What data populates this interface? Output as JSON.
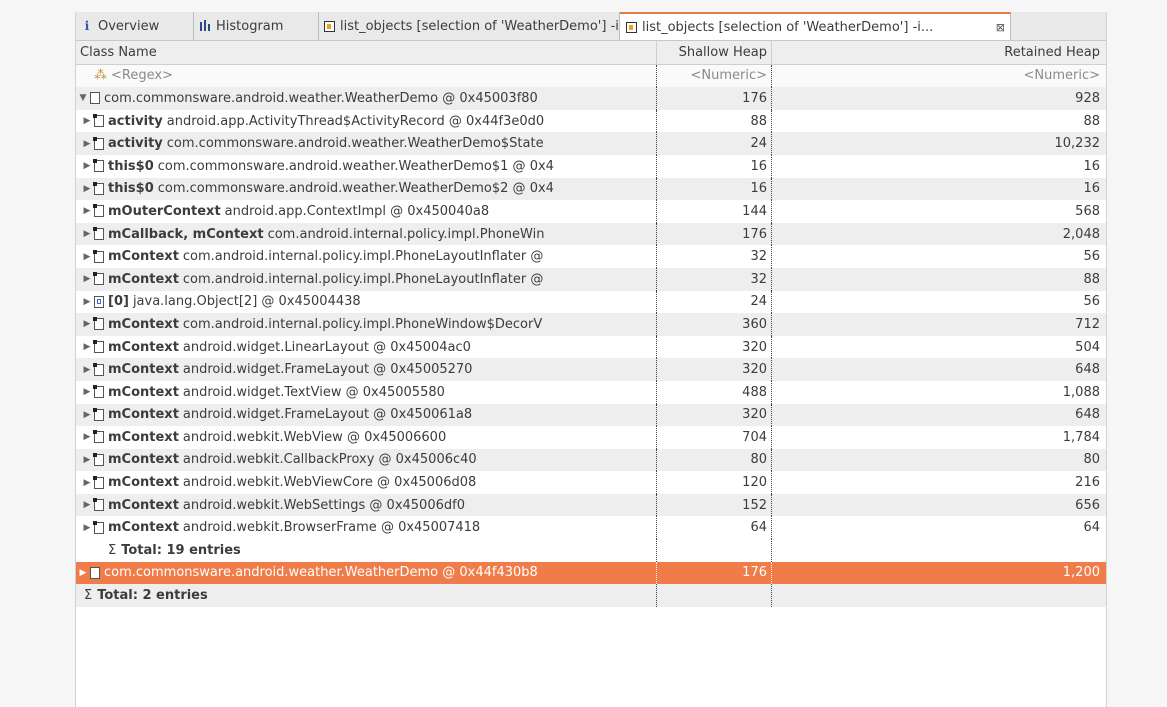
{
  "tabs": [
    {
      "icon": "info-icon",
      "label": "Overview"
    },
    {
      "icon": "histogram-icon",
      "label": "Histogram"
    },
    {
      "icon": "list-objects-icon",
      "label": "list_objects [selection of 'WeatherDemo'] -i..."
    },
    {
      "icon": "list-objects-icon",
      "label": "list_objects [selection of 'WeatherDemo'] -i...",
      "active": true,
      "close": "⊠"
    }
  ],
  "columns": {
    "class_name": "Class Name",
    "shallow_heap": "Shallow Heap",
    "retained_heap": "Retained Heap"
  },
  "filters": {
    "regex": "<Regex>",
    "shallow": "<Numeric>",
    "retained": "<Numeric>"
  },
  "root": {
    "name": "com.commonsware.android.weather.WeatherDemo @ 0x45003f80",
    "shallow": "176",
    "retained": "928"
  },
  "children": [
    {
      "field": "activity",
      "text": "android.app.ActivityThread$ActivityRecord @ 0x44f3e0d0",
      "shallow": "88",
      "retained": "88",
      "icon": "ref"
    },
    {
      "field": "activity",
      "text": "com.commonsware.android.weather.WeatherDemo$State",
      "shallow": "24",
      "retained": "10,232",
      "icon": "ref"
    },
    {
      "field": "this$0",
      "text": "com.commonsware.android.weather.WeatherDemo$1 @ 0x4",
      "shallow": "16",
      "retained": "16",
      "icon": "ref"
    },
    {
      "field": "this$0",
      "text": "com.commonsware.android.weather.WeatherDemo$2 @ 0x4",
      "shallow": "16",
      "retained": "16",
      "icon": "ref"
    },
    {
      "field": "mOuterContext",
      "text": "android.app.ContextImpl @ 0x450040a8",
      "shallow": "144",
      "retained": "568",
      "icon": "ref"
    },
    {
      "field": "mCallback, mContext",
      "text": "com.android.internal.policy.impl.PhoneWin",
      "shallow": "176",
      "retained": "2,048",
      "icon": "ref"
    },
    {
      "field": "mContext",
      "text": "com.android.internal.policy.impl.PhoneLayoutInflater @",
      "shallow": "32",
      "retained": "56",
      "icon": "ref"
    },
    {
      "field": "mContext",
      "text": "com.android.internal.policy.impl.PhoneLayoutInflater @",
      "shallow": "32",
      "retained": "88",
      "icon": "ref"
    },
    {
      "field": "[0]",
      "text": "java.lang.Object[2] @ 0x45004438",
      "shallow": "24",
      "retained": "56",
      "icon": "arr"
    },
    {
      "field": "mContext",
      "text": "com.android.internal.policy.impl.PhoneWindow$DecorV",
      "shallow": "360",
      "retained": "712",
      "icon": "ref"
    },
    {
      "field": "mContext",
      "text": "android.widget.LinearLayout @ 0x45004ac0",
      "shallow": "320",
      "retained": "504",
      "icon": "ref"
    },
    {
      "field": "mContext",
      "text": "android.widget.FrameLayout @ 0x45005270",
      "shallow": "320",
      "retained": "648",
      "icon": "ref"
    },
    {
      "field": "mContext",
      "text": "android.widget.TextView @ 0x45005580",
      "shallow": "488",
      "retained": "1,088",
      "icon": "ref"
    },
    {
      "field": "mContext",
      "text": "android.widget.FrameLayout @ 0x450061a8",
      "shallow": "320",
      "retained": "648",
      "icon": "ref"
    },
    {
      "field": "mContext",
      "text": "android.webkit.WebView @ 0x45006600",
      "shallow": "704",
      "retained": "1,784",
      "icon": "ref"
    },
    {
      "field": "mContext",
      "text": "android.webkit.CallbackProxy @ 0x45006c40",
      "shallow": "80",
      "retained": "80",
      "icon": "ref"
    },
    {
      "field": "mContext",
      "text": "android.webkit.WebViewCore @ 0x45006d08",
      "shallow": "120",
      "retained": "216",
      "icon": "ref"
    },
    {
      "field": "mContext",
      "text": "android.webkit.WebSettings @ 0x45006df0",
      "shallow": "152",
      "retained": "656",
      "icon": "ref"
    },
    {
      "field": "mContext",
      "text": "android.webkit.BrowserFrame @ 0x45007418",
      "shallow": "64",
      "retained": "64",
      "icon": "ref"
    }
  ],
  "total_children": "Total: 19 entries",
  "second_root": {
    "name": "com.commonsware.android.weather.WeatherDemo @ 0x44f430b8",
    "shallow": "176",
    "retained": "1,200"
  },
  "total_roots": "Total: 2 entries",
  "sigma": "Σ",
  "colors": {
    "selection": "#f07c4a",
    "active_tab_accent": "#e07a4b"
  }
}
